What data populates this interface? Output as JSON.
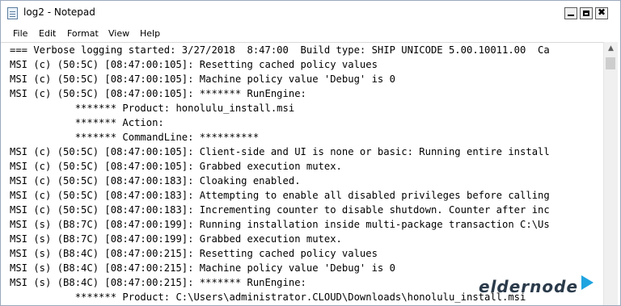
{
  "window": {
    "title": "log2 - Notepad"
  },
  "menu": {
    "items": [
      "File",
      "Edit",
      "Format",
      "View",
      "Help"
    ]
  },
  "controls": {
    "minimize": "minimize",
    "maximize": "maximize",
    "close": "✖"
  },
  "lines": [
    "=== Verbose logging started: 3/27/2018  8:47:00  Build type: SHIP UNICODE 5.00.10011.00  Ca",
    "MSI (c) (50:5C) [08:47:00:105]: Resetting cached policy values",
    "MSI (c) (50:5C) [08:47:00:105]: Machine policy value 'Debug' is 0",
    "MSI (c) (50:5C) [08:47:00:105]: ******* RunEngine:",
    "           ******* Product: honolulu_install.msi",
    "           ******* Action:",
    "           ******* CommandLine: **********",
    "MSI (c) (50:5C) [08:47:00:105]: Client-side and UI is none or basic: Running entire install",
    "MSI (c) (50:5C) [08:47:00:105]: Grabbed execution mutex.",
    "MSI (c) (50:5C) [08:47:00:183]: Cloaking enabled.",
    "MSI (c) (50:5C) [08:47:00:183]: Attempting to enable all disabled privileges before calling",
    "MSI (c) (50:5C) [08:47:00:183]: Incrementing counter to disable shutdown. Counter after inc",
    "MSI (s) (B8:7C) [08:47:00:199]: Running installation inside multi-package transaction C:\\Us",
    "MSI (s) (B8:7C) [08:47:00:199]: Grabbed execution mutex.",
    "MSI (s) (B8:4C) [08:47:00:215]: Resetting cached policy values",
    "MSI (s) (B8:4C) [08:47:00:215]: Machine policy value 'Debug' is 0",
    "MSI (s) (B8:4C) [08:47:00:215]: ******* RunEngine:",
    "           ******* Product: C:\\Users\\administrator.CLOUD\\Downloads\\honolulu_install.msi"
  ],
  "watermark": {
    "text": "eldernode",
    "accent_color": "#1fa4e0",
    "icon": "arrow-logo-icon"
  },
  "scrollbar": {
    "up_arrow": "▲"
  }
}
